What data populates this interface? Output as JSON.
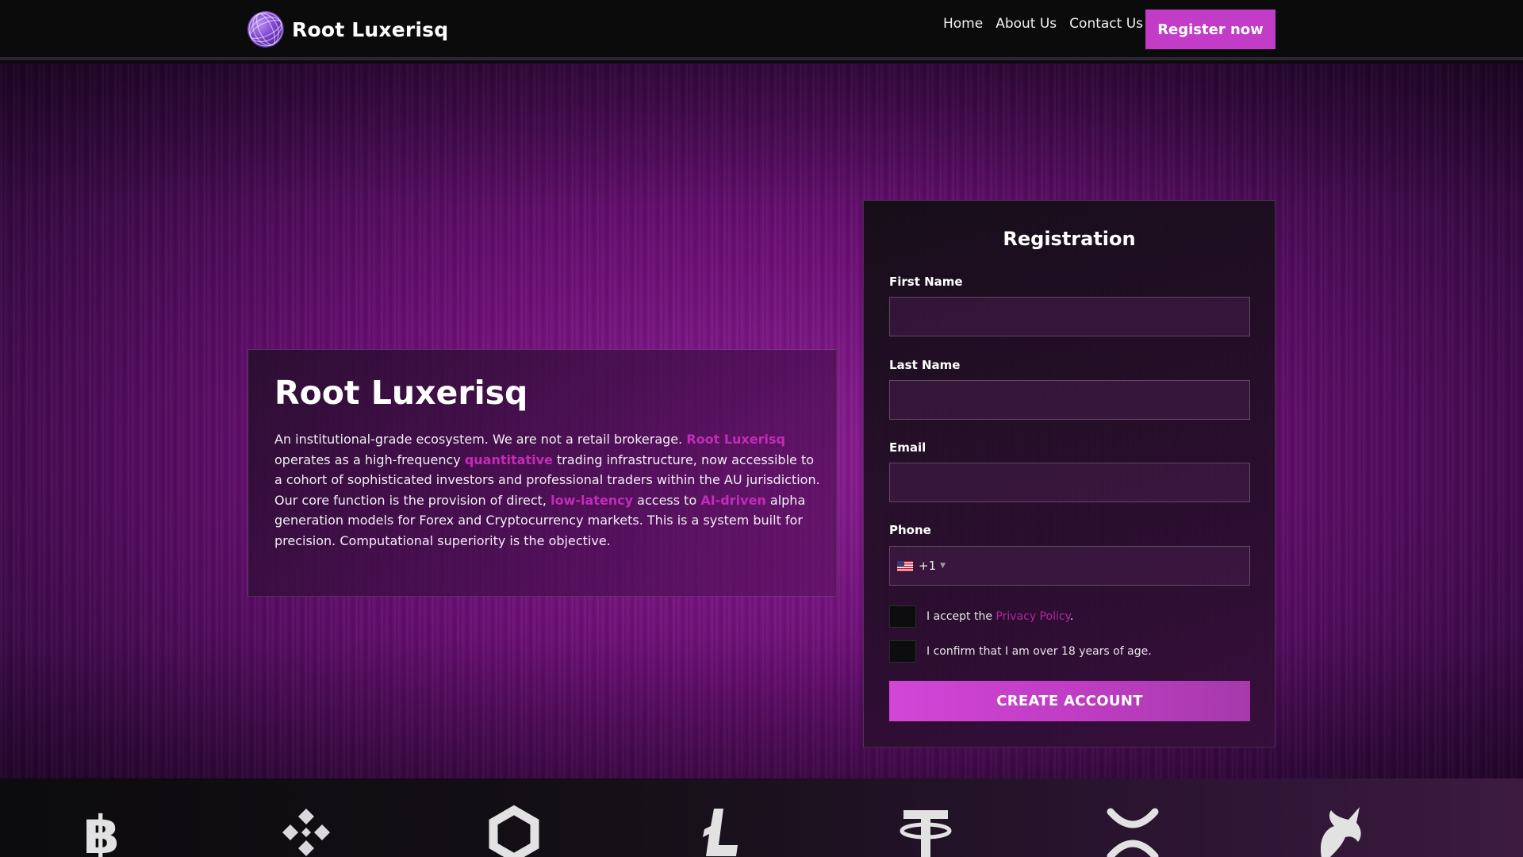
{
  "header": {
    "brand_name": "Root Luxerisq",
    "nav": [
      "Home",
      "About Us",
      "Contact Us"
    ],
    "register_label": "Register now"
  },
  "intro": {
    "title": "Root Luxerisq",
    "segments": [
      "An institutional-grade ecosystem. We are not a retail brokerage. ",
      "Root Luxerisq",
      " operates as a high-frequency ",
      "quantitative",
      " trading infrastructure, now accessible to a cohort of sophisticated investors and professional traders within the AU jurisdiction. Our core function is the provision of direct, ",
      "low-latency",
      " access to ",
      "AI-driven",
      " alpha generation models for Forex and Cryptocurrency markets. This is a system built for precision. Computational superiority is the objective."
    ]
  },
  "registration": {
    "title": "Registration",
    "first_name_label": "First Name",
    "last_name_label": "Last Name",
    "email_label": "Email",
    "phone_label": "Phone",
    "phone_dial_code": "+1",
    "privacy_prefix": "I accept the ",
    "privacy_link": "Privacy Policy",
    "privacy_suffix": ".",
    "age_confirm": "I confirm that I am over 18 years of age.",
    "submit_label": "CREATE ACCOUNT"
  },
  "colors": {
    "accent": "#c23cc8",
    "highlight": "#c42bb8",
    "header_bg": "#0b0b0c"
  },
  "coin_icons": [
    "bitcoin-icon",
    "binance-icon",
    "chainlink-icon",
    "litecoin-icon",
    "tether-icon",
    "xrp-icon",
    "uniswap-icon"
  ]
}
